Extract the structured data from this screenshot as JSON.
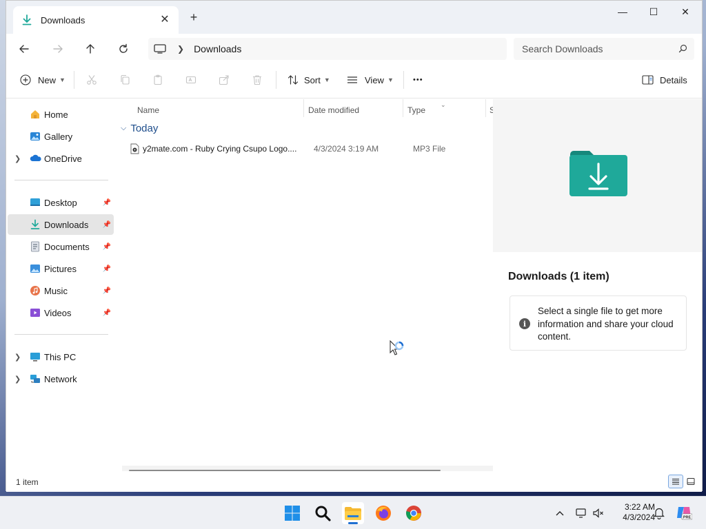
{
  "titlebar": {
    "tab_title": "Downloads",
    "tab_close": "✕",
    "new_tab": "+",
    "minimize": "—",
    "maximize": "☐",
    "close": "✕"
  },
  "addressbar": {
    "breadcrumb": "Downloads",
    "search_placeholder": "Search Downloads"
  },
  "commandbar": {
    "new_label": "New",
    "sort_label": "Sort",
    "view_label": "View",
    "more_label": "•••",
    "details_label": "Details"
  },
  "navpane": {
    "items": [
      {
        "label": "Home",
        "icon": "home-icon"
      },
      {
        "label": "Gallery",
        "icon": "gallery-icon"
      },
      {
        "label": "OneDrive",
        "icon": "onedrive-icon"
      },
      {
        "label": "Desktop",
        "icon": "desktop-icon"
      },
      {
        "label": "Downloads",
        "icon": "downloads-icon"
      },
      {
        "label": "Documents",
        "icon": "documents-icon"
      },
      {
        "label": "Pictures",
        "icon": "pictures-icon"
      },
      {
        "label": "Music",
        "icon": "music-icon"
      },
      {
        "label": "Videos",
        "icon": "videos-icon"
      },
      {
        "label": "This PC",
        "icon": "this-pc-icon"
      },
      {
        "label": "Network",
        "icon": "network-icon"
      }
    ]
  },
  "filelist": {
    "columns": [
      "Name",
      "Date modified",
      "Type",
      "S"
    ],
    "group": "Today",
    "files": [
      {
        "name": "y2mate.com - Ruby Crying Csupo Logo....",
        "date": "4/3/2024 3:19 AM",
        "type": "MP3 File"
      }
    ]
  },
  "details": {
    "title": "Downloads (1 item)",
    "info": "Select a single file to get more information and share your cloud content."
  },
  "status": {
    "count": "1 item"
  },
  "taskbar": {
    "time": "3:22 AM",
    "date": "4/3/2024"
  },
  "colors": {
    "accent": "#1f6fd1",
    "folder_teal": "#1fa99a",
    "selected_bg": "#e5e5e5"
  }
}
